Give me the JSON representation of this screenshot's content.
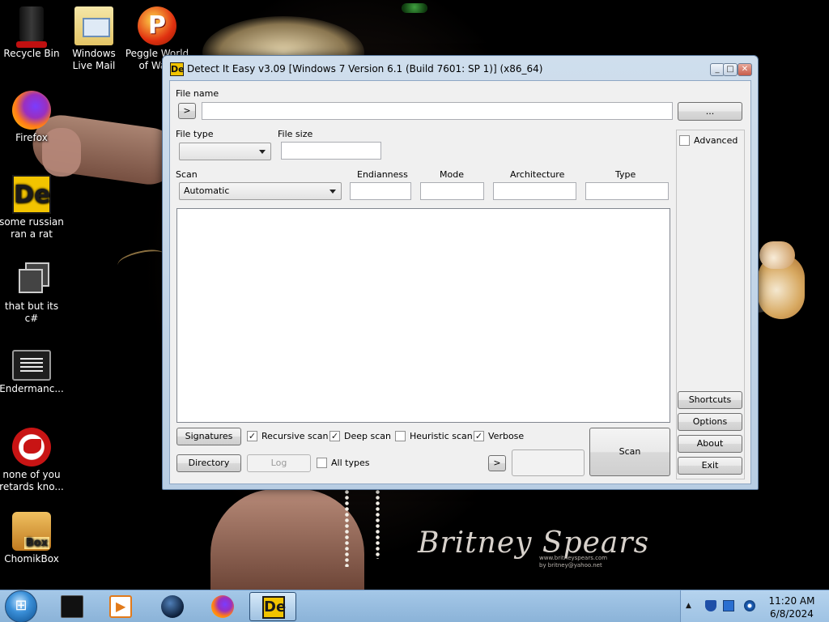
{
  "desktop": {
    "icons": [
      {
        "label": "Recycle Bin",
        "icon": "recycle-bin-icon"
      },
      {
        "label": "Windows Live Mail",
        "icon": "mail-icon"
      },
      {
        "label": "Peggle World of Warc",
        "icon": "peggle-icon"
      },
      {
        "label": "Firefox",
        "icon": "firefox-icon"
      },
      {
        "label": "some russian ran a rat",
        "icon": "die-icon"
      },
      {
        "label": "that but its c#",
        "icon": "copy-icon"
      },
      {
        "label": "Endermanc...",
        "icon": "terminal-icon"
      },
      {
        "label": "none of you retards kno...",
        "icon": "rat-icon"
      },
      {
        "label": "ChomikBox",
        "icon": "chomikbox-icon"
      }
    ],
    "wallpaper_signature": "Britney Spears",
    "wallpaper_url": "www.britneyspears.com",
    "wallpaper_url2": "by britney@yahoo.net"
  },
  "window": {
    "title": "Detect It Easy v3.09 [Windows 7 Version 6.1 (Build 7601: SP 1)] (x86_64)",
    "app_icon_text": "De",
    "controls": {
      "minimize": "_",
      "maximize": "□",
      "close": "✕"
    }
  },
  "form": {
    "file_name_label": "File name",
    "file_name_value": "",
    "history_button": ">",
    "browse_button": "...",
    "file_type_label": "File type",
    "file_type_value": "",
    "file_size_label": "File size",
    "file_size_value": "",
    "advanced_label": "Advanced",
    "advanced_checked": false,
    "scan_label": "Scan",
    "scan_value": "Automatic",
    "endianness_label": "Endianness",
    "mode_label": "Mode",
    "architecture_label": "Architecture",
    "type_label": "Type",
    "endianness_value": "",
    "mode_value": "",
    "architecture_value": "",
    "type_value": ""
  },
  "bottom": {
    "signatures_button": "Signatures",
    "recursive_scan": {
      "label": "Recursive scan",
      "checked": true
    },
    "deep_scan": {
      "label": "Deep scan",
      "checked": true
    },
    "heuristic_scan": {
      "label": "Heuristic scan",
      "checked": false
    },
    "verbose": {
      "label": "Verbose",
      "checked": true
    },
    "directory_button": "Directory",
    "log_button": "Log",
    "all_types": {
      "label": "All types",
      "checked": false
    },
    "next_button": ">",
    "scan_button": "Scan"
  },
  "side_buttons": {
    "shortcuts": "Shortcuts",
    "options": "Options",
    "about": "About",
    "exit": "Exit"
  },
  "checkmark": "✓",
  "taskbar": {
    "items": [
      "terminal-icon",
      "media-player-icon",
      "globe-icon",
      "firefox-icon",
      "die-icon"
    ],
    "active_item": "die-icon",
    "clock_time": "11:20 AM",
    "clock_date": "6/8/2024",
    "tray_arrow": "▲"
  }
}
